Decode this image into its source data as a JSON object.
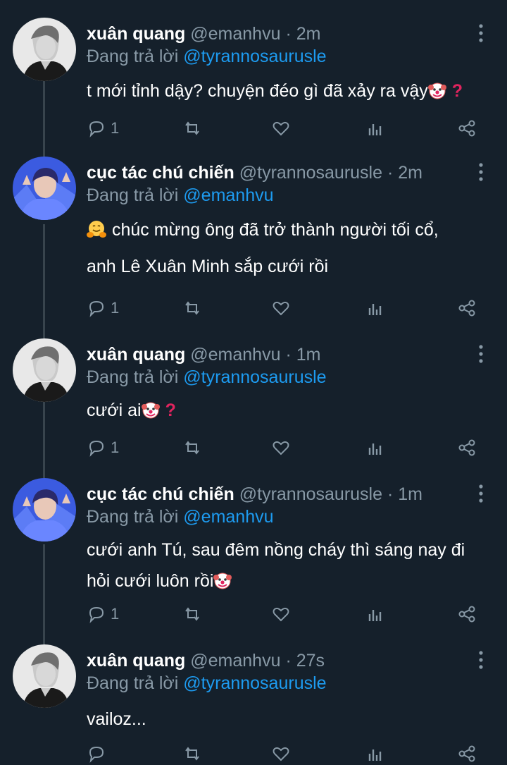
{
  "tweets": [
    {
      "name": "xuân quang",
      "handle": "@emanhvu",
      "time": "2m",
      "reply_label": "Đang trả lời",
      "reply_to": "@tyrannosaurusle",
      "text_lines": [
        "t mới tỉnh dậy? chuyện đéo gì đã xảy ra vậy"
      ],
      "reply_count": "1",
      "avatar": "avatar-dark-portrait"
    },
    {
      "name": "cục tác chú chiến",
      "handle": "@tyrannosaurusle",
      "time": "2m",
      "reply_label": "Đang trả lời",
      "reply_to": "@emanhvu",
      "text_lines": [
        "chúc mừng ông đã trở thành người tối cổ,",
        "anh Lê Xuân Minh sắp cưới rồi"
      ],
      "reply_count": "1",
      "avatar": "avatar-blue-portrait"
    },
    {
      "name": "xuân quang",
      "handle": "@emanhvu",
      "time": "1m",
      "reply_label": "Đang trả lời",
      "reply_to": "@tyrannosaurusle",
      "text_lines": [
        "cưới ai"
      ],
      "reply_count": "1",
      "avatar": "avatar-dark-portrait"
    },
    {
      "name": "cục tác chú chiến",
      "handle": "@tyrannosaurusle",
      "time": "1m",
      "reply_label": "Đang trả lời",
      "reply_to": "@emanhvu",
      "text_lines": [
        "cưới anh Tú, sau đêm nồng cháy thì sáng nay đi",
        "hỏi cưới luôn rồi"
      ],
      "reply_count": "1",
      "avatar": "avatar-blue-portrait"
    },
    {
      "name": "xuân quang",
      "handle": "@emanhvu",
      "time": "27s",
      "reply_label": "Đang trả lời",
      "reply_to": "@tyrannosaurusle",
      "text_lines": [
        "vailoz..."
      ],
      "reply_count": "",
      "avatar": "avatar-dark-portrait"
    }
  ],
  "colors": {
    "background": "#15202b",
    "muted": "#8899a6",
    "link": "#1d9bf0",
    "thread_line": "#38444d"
  }
}
